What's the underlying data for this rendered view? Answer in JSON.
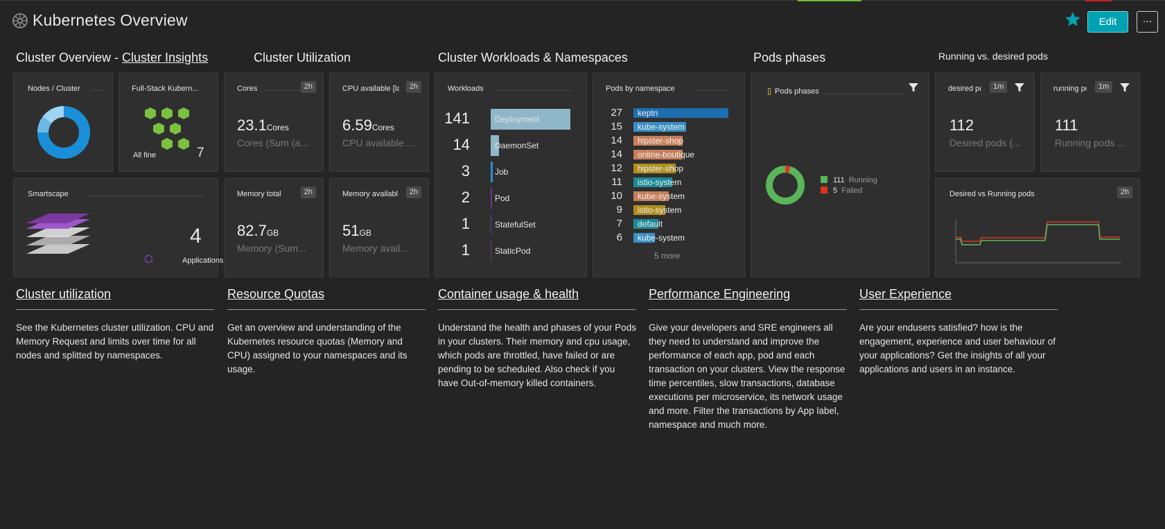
{
  "header": {
    "title": "Kubernetes Overview",
    "edit_label": "Edit",
    "more_label": "···",
    "accent": "#00a1b2"
  },
  "sections": {
    "cluster_overview_prefix": "Cluster Overview - ",
    "cluster_overview_link": "Cluster Insights",
    "cluster_utilization": "Cluster Utilization",
    "workloads_namespaces": "Cluster Workloads & Namespaces",
    "pods_phases": "Pods phases",
    "running_vs_desired": "Running vs. desired pods"
  },
  "tiles": {
    "nodes": {
      "label": "Nodes / Cluster"
    },
    "fullstack": {
      "label": "Full-Stack Kubern...",
      "status": "All fine",
      "count": "7"
    },
    "cores": {
      "label": "Cores",
      "badge": "2h",
      "value": "23.1",
      "unit": "Cores",
      "sub": "Cores (Sum (a..."
    },
    "cpu_available": {
      "label": "CPU available [la",
      "badge": "2h",
      "value": "6.59",
      "unit": "Cores",
      "sub": "CPU available ..."
    },
    "smartscape": {
      "label": "Smartscape",
      "count": "4",
      "legend": "Applications"
    },
    "memory_total": {
      "label": "Memory total",
      "badge": "2h",
      "value": "82.7",
      "unit": "GB",
      "sub": "Memory (Sum..."
    },
    "memory_available": {
      "label": "Memory availabl",
      "badge": "2h",
      "value": "51",
      "unit": "GB",
      "sub": "Memory avail..."
    },
    "workloads": {
      "label": "Workloads",
      "rows": [
        {
          "value": "141",
          "name": "Deployment"
        },
        {
          "value": "14",
          "name": "DaemonSet"
        },
        {
          "value": "3",
          "name": "Job"
        },
        {
          "value": "2",
          "name": "Pod"
        },
        {
          "value": "1",
          "name": "StatefulSet"
        },
        {
          "value": "1",
          "name": "StaticPod"
        }
      ]
    },
    "pods_by_namespace": {
      "label": "Pods by namespace",
      "rows": [
        {
          "value": "27",
          "name": "keptn"
        },
        {
          "value": "15",
          "name": "kube-system"
        },
        {
          "value": "14",
          "name": "hipster-shop"
        },
        {
          "value": "14",
          "name": "online-boutique"
        },
        {
          "value": "12",
          "name": "hipster-shop"
        },
        {
          "value": "11",
          "name": "istio-system"
        },
        {
          "value": "10",
          "name": "kube-system"
        },
        {
          "value": "9",
          "name": "istio-system"
        },
        {
          "value": "7",
          "name": "default"
        },
        {
          "value": "6",
          "name": "kube-system"
        }
      ],
      "more": "5 more"
    },
    "pods_phases": {
      "label": "Pods phases",
      "running_value": "111",
      "running_label": "Running",
      "failed_value": "5",
      "failed_label": "Failed",
      "running_fraction": 0.957,
      "running_color": "#5bb55a",
      "failed_color": "#e0341f"
    },
    "desired_pods": {
      "label": "desired pc",
      "badge": "1m",
      "value": "112",
      "sub": "Desired pods (..."
    },
    "running_pods": {
      "label": "running pc",
      "badge": "1m",
      "value": "111",
      "sub": "Running pods ..."
    },
    "desired_vs_running": {
      "label": "Desired vs Running pods",
      "badge": "2h"
    }
  },
  "articles": [
    {
      "heading": "Cluster utilization",
      "text": "See the Kubernetes cluster utilization. CPU and Memory Request and limits over time for all nodes and splitted by namespaces."
    },
    {
      "heading": "Resource Quotas",
      "text": "Get an overview and understanding of the Kubernetes resource quotas (Memory and CPU) assigned to your namespaces and its usage."
    },
    {
      "heading": "Container usage & health",
      "text": "Understand the health and phases of your Pods in your clusters. Their memory and cpu usage, which pods are throttled, have failed or are pending to be scheduled. Also check if you have Out-of-memory killed containers."
    },
    {
      "heading": "Performance Engineering",
      "text": "Give your developers and SRE engineers all they need to understand and improve the performance of each app, pod and each transaction on your clusters. View the response time percentiles, slow transactions, database executions per microservice, its network usage and more. Filter the transactions by App label, namespace and much more."
    },
    {
      "heading": "User Experience",
      "text": "Are your endusers satisfied? how is the engagement, experience and user behaviour of your applications? Get the insights of all your applications and users in an instance."
    }
  ]
}
